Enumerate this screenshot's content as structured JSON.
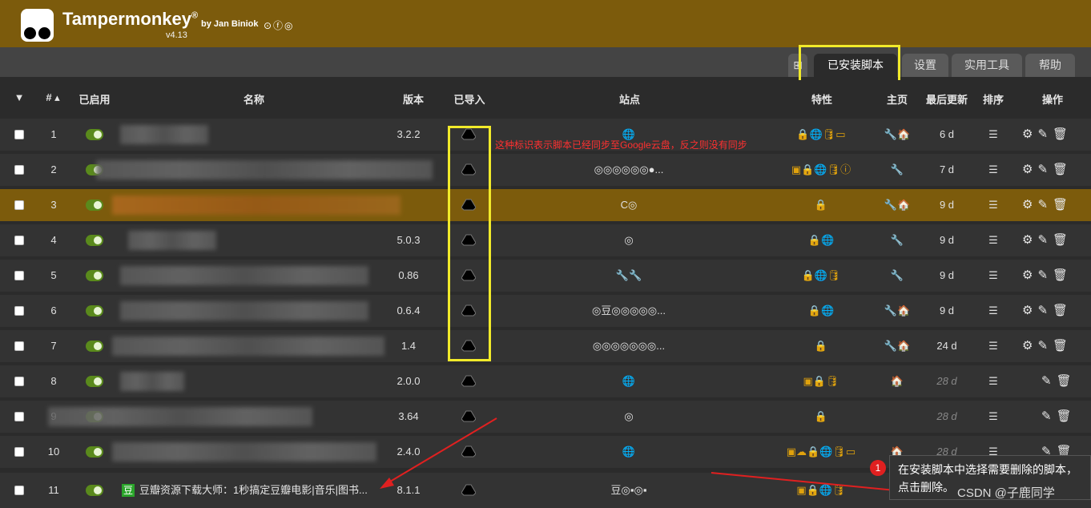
{
  "app": {
    "name": "Tampermonkey",
    "version": "v4.13",
    "by": "by Jan Biniok",
    "social": "⊙ⓕ◎"
  },
  "tabs": [
    {
      "label": "⊞"
    },
    {
      "label": "已安装脚本"
    },
    {
      "label": "设置"
    },
    {
      "label": "实用工具"
    },
    {
      "label": "帮助"
    }
  ],
  "columns": {
    "filter": "▼",
    "num": "# ▴",
    "enabled": "已启用",
    "name": "名称",
    "version": "版本",
    "imported": "已导入",
    "sites": "站点",
    "features": "特性",
    "home": "主页",
    "updated": "最后更新",
    "order": "排序",
    "actions": "操作"
  },
  "rows": [
    {
      "num": "1",
      "version": "3.2.2",
      "updated": "6 d",
      "sites": "🌐",
      "features": "🔒🌐🛢▭",
      "home": "🔧🏠",
      "actions": "⚙✎🗑"
    },
    {
      "num": "2",
      "version": "",
      "updated": "7 d",
      "sites": "◎◎◎◎◎◎●...",
      "features": "▣🔒🌐🛢ⓘ",
      "home": "🔧",
      "actions": "⚙✎🗑"
    },
    {
      "num": "3",
      "version": "",
      "updated": "9 d",
      "sites": "C◎",
      "features": "🔒",
      "home": "🔧🏠",
      "actions": "⚙✎🗑"
    },
    {
      "num": "4",
      "version": "5.0.3",
      "updated": "9 d",
      "sites": "◎",
      "features": "🔒🌐",
      "home": "🔧",
      "actions": "⚙✎🗑"
    },
    {
      "num": "5",
      "version": "0.86",
      "updated": "9 d",
      "sites": "🔧🔧",
      "features": "🔒🌐🛢",
      "home": "🔧",
      "actions": "⚙✎🗑"
    },
    {
      "num": "6",
      "version": "0.6.4",
      "updated": "9 d",
      "sites": "◎豆◎◎◎◎◎...",
      "features": "🔒🌐",
      "home": "🔧🏠",
      "actions": "⚙✎🗑"
    },
    {
      "num": "7",
      "version": "1.4",
      "updated": "24 d",
      "sites": "◎◎◎◎◎◎◎...",
      "features": "🔒",
      "home": "🔧🏠",
      "actions": "⚙✎🗑"
    },
    {
      "num": "8",
      "version": "2.0.0",
      "updated": "28 d",
      "sites": "🌐",
      "features": "▣🔒🛢",
      "home": "🏠",
      "actions": "✎🗑"
    },
    {
      "num": "9",
      "version": "3.64",
      "updated": "28 d",
      "sites": "◎",
      "features": "🔒",
      "home": "",
      "actions": "✎🗑"
    },
    {
      "num": "10",
      "version": "2.4.0",
      "updated": "28 d",
      "sites": "🌐",
      "features": "▣☁🔒🌐🛢▭",
      "home": "🏠",
      "actions": "✎🗑"
    },
    {
      "num": "11",
      "version": "8.1.1",
      "updated": "",
      "sites": "豆◎▪◎▪",
      "features": "▣🔒🌐🛢",
      "home": "",
      "actions": "",
      "name": "豆瓣资源下载大师：1秒搞定豆瓣电影|音乐|图书..."
    }
  ],
  "annotations": {
    "red_note": "这种标识表示脚本已经同步至Google云盘，反之则没有同步",
    "tip": "在安装脚本中选择需要删除的脚本，点击删除。",
    "badge": "1",
    "watermark": "CSDN @子鹿同学"
  },
  "colors": {
    "header": "#7c5b0c",
    "selected_row": "#7c5b0c",
    "highlight": "#f1ea2a",
    "arrow": "#e02020"
  }
}
